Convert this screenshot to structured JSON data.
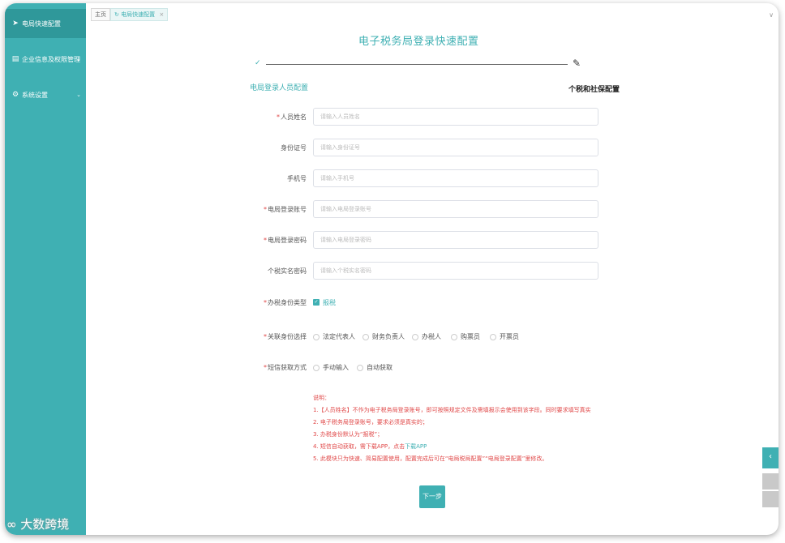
{
  "sidebar": {
    "items": [
      {
        "label": "电局快速配置",
        "icon": "send-icon"
      },
      {
        "label": "企业信息及权限管理",
        "icon": "building-icon"
      },
      {
        "label": "系统设置",
        "icon": "gear-icon"
      }
    ]
  },
  "tabs": [
    {
      "label": "主页"
    },
    {
      "label": "电局快速配置",
      "close": "×"
    }
  ],
  "page_title": "电子税务局登录快速配置",
  "steps": [
    {
      "label": "电局登录人员配置",
      "icon": "check-icon"
    },
    {
      "label": "个税和社保配置",
      "icon": "pen-icon"
    }
  ],
  "form": {
    "fields": [
      {
        "label": "人员姓名",
        "required": true,
        "placeholder": "请输入人员姓名"
      },
      {
        "label": "身份证号",
        "required": false,
        "placeholder": "请输入身份证号"
      },
      {
        "label": "手机号",
        "required": false,
        "placeholder": "请输入手机号"
      },
      {
        "label": "电局登录账号",
        "required": true,
        "placeholder": "请输入电局登录账号"
      },
      {
        "label": "电局登录密码",
        "required": true,
        "placeholder": "请输入电局登录密码"
      },
      {
        "label": "个税实名密码",
        "required": false,
        "placeholder": "请输入个税实名密码"
      }
    ],
    "tax_identity": {
      "label": "办税身份类型",
      "option": "报税",
      "checked": true
    },
    "relation": {
      "label": "关联身份选择",
      "options": [
        "法定代表人",
        "财务负责人",
        "办税人",
        "购票员",
        "开票员"
      ]
    },
    "sms": {
      "label": "短信获取方式",
      "options": [
        "手动输入",
        "自动获取"
      ]
    }
  },
  "notes": {
    "title": "说明：",
    "lines": [
      "1.【人员姓名】不作为电子税务局登录账号，即可按照规定文件及需填报示会使用到该字段。同时要求填写真实",
      "2. 电子税务局登录账号，要求必须是真实的；",
      "3. 办税身份默认为“报税”；",
      "4. 短信自动获取，需下载APP，点击",
      "5. 此模块只为快速、简易配置使用，配置完成后可在“电局税局配置”“电局登录配置”里修改。"
    ],
    "link": "下载APP"
  },
  "next_button": "下一步",
  "watermark": "大数跨境",
  "colors": {
    "accent": "#3fb0b3",
    "required": "#e04848"
  }
}
